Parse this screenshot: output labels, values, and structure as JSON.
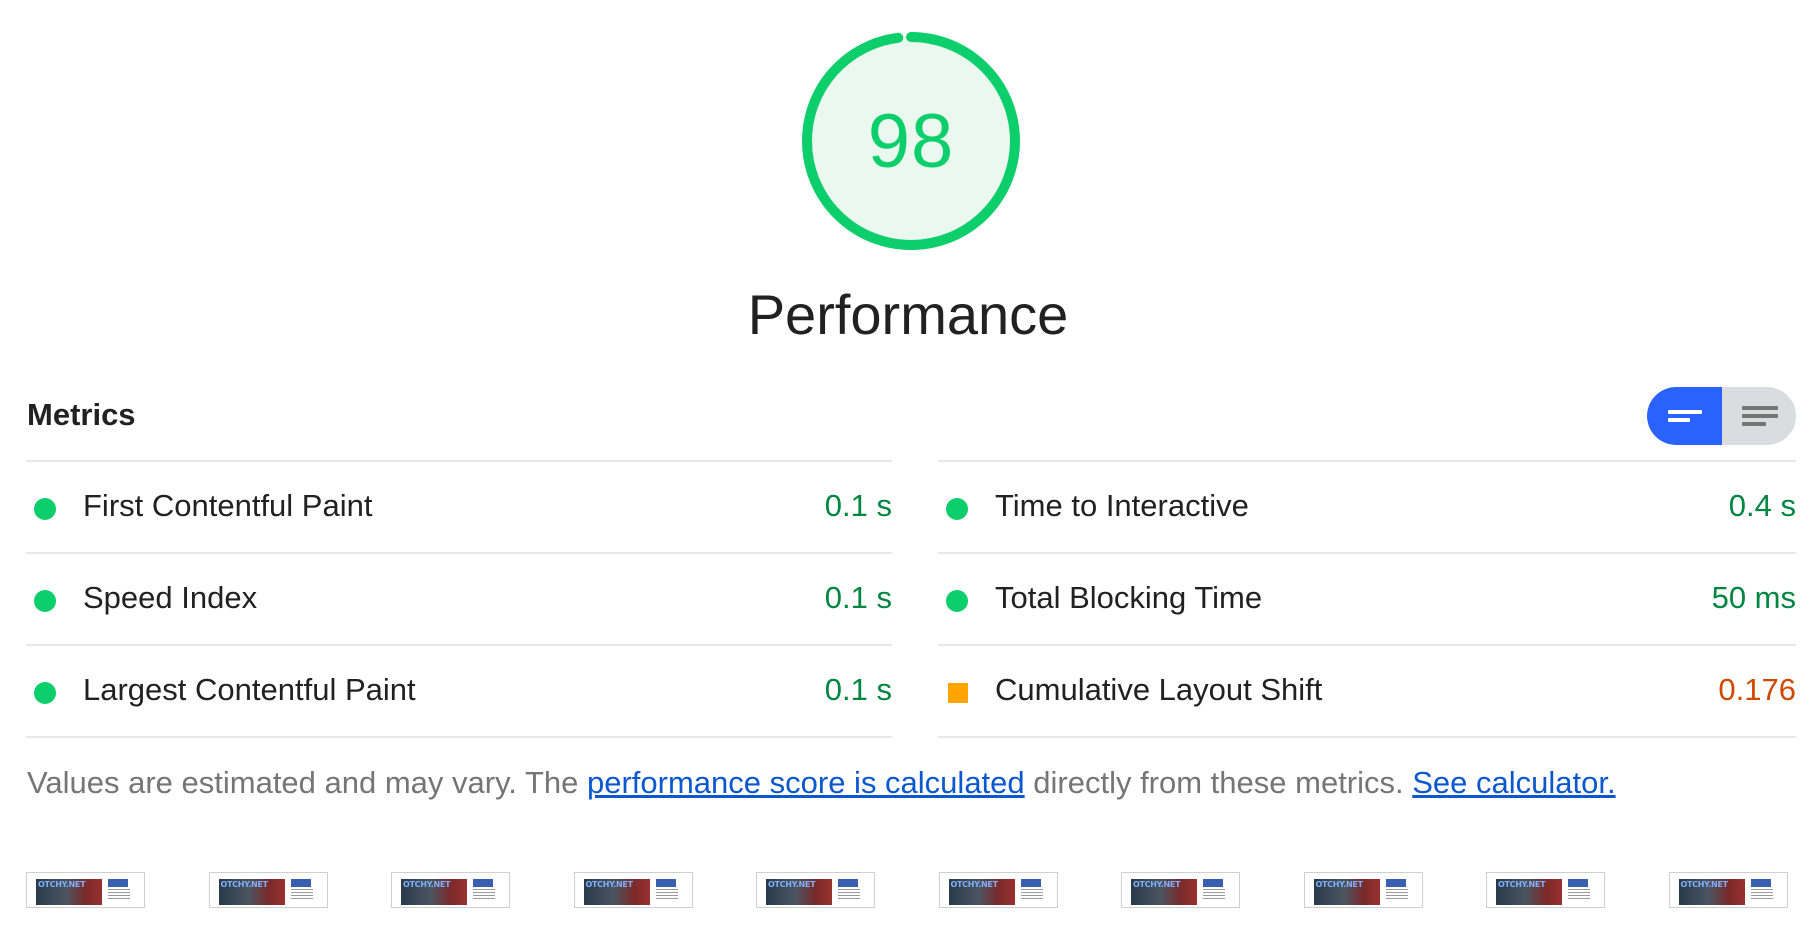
{
  "gauge": {
    "score": "98",
    "score_fraction": 0.98,
    "title": "Performance",
    "color": "#0cce6b"
  },
  "metrics": {
    "header": "Metrics",
    "toggle": {
      "options": [
        "bars-view-icon",
        "list-view-icon"
      ],
      "selected": "bars-view-icon"
    },
    "left": [
      {
        "label": "First Contentful Paint",
        "value": "0.1 s",
        "status": "pass"
      },
      {
        "label": "Speed Index",
        "value": "0.1 s",
        "status": "pass"
      },
      {
        "label": "Largest Contentful Paint",
        "value": "0.1 s",
        "status": "pass"
      }
    ],
    "right": [
      {
        "label": "Time to Interactive",
        "value": "0.4 s",
        "status": "pass"
      },
      {
        "label": "Total Blocking Time",
        "value": "50 ms",
        "status": "pass"
      },
      {
        "label": "Cumulative Layout Shift",
        "value": "0.176",
        "status": "average"
      }
    ]
  },
  "footnote": {
    "text_before": "Values are estimated and may vary. The ",
    "link1": "performance score is calculated",
    "text_middle": " directly from these metrics. ",
    "link2": "See calculator."
  },
  "filmstrip": {
    "frame_count": 10,
    "frame_logo": "OTCHY.NET"
  },
  "colors": {
    "pass": "#0cce6b",
    "pass_text": "#018642",
    "average": "#ffa400",
    "average_text": "#d04900",
    "toggle_active": "#2962ff"
  }
}
